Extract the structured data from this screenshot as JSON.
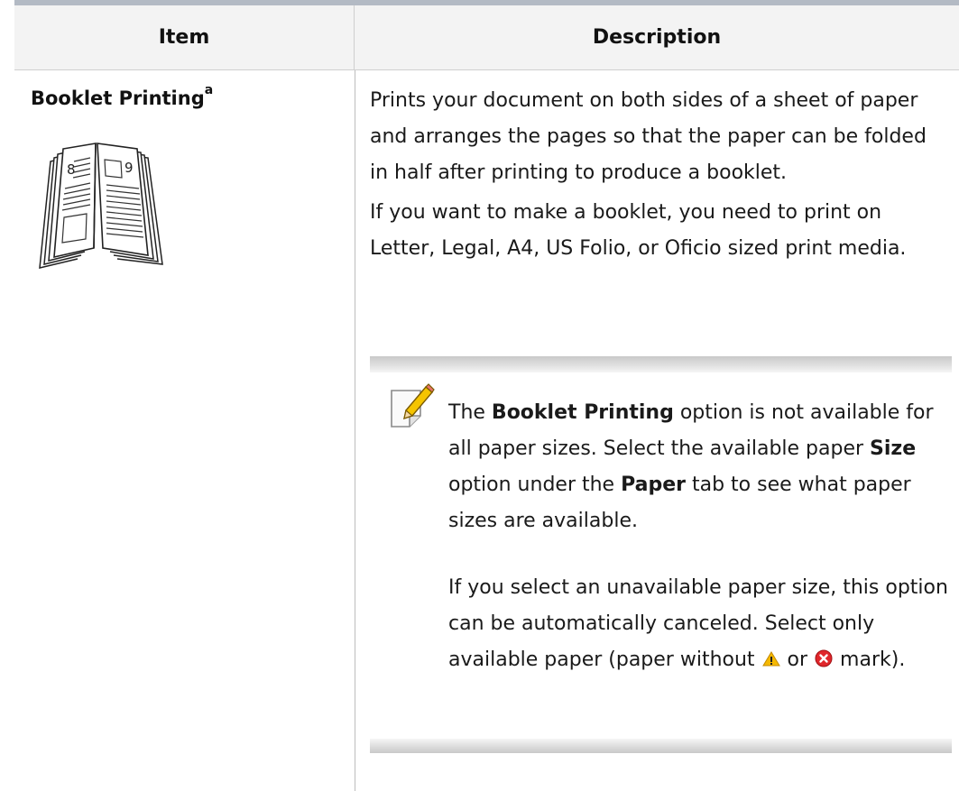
{
  "table": {
    "header": {
      "item": "Item",
      "description": "Description"
    },
    "row": {
      "title": "Booklet Printing",
      "title_superscript": "a",
      "icon": "booklet-icon",
      "description_paragraphs": [
        "Prints your document on both sides of a sheet of paper and arranges the pages so that the paper can be folded in half after printing to produce a booklet.",
        "If you want to make a booklet, you need to print on Letter, Legal, A4, US Folio, or Oficio sized print media."
      ],
      "note": {
        "icon": "note-pencil-icon",
        "p1": {
          "t1": "The ",
          "b1": "Booklet Printing",
          "t2": " option is not available for all paper sizes. Select the available paper ",
          "b2": "Size",
          "t3": " option under the ",
          "b3": "Paper",
          "t4": " tab to see what paper sizes are available."
        },
        "p2": {
          "t1": "If you select an unavailable paper size, this option can be automatically canceled. Select only available paper (paper without ",
          "icon_warning": "warning-icon",
          "t2": " or ",
          "icon_error": "error-icon",
          "t3": " mark)."
        }
      },
      "booklet_page_numbers": [
        "8",
        "9"
      ]
    }
  },
  "colors": {
    "top_rule": "#b3bac4",
    "header_bg": "#f3f3f3",
    "warning": "#f5b800",
    "error": "#e0262b"
  }
}
